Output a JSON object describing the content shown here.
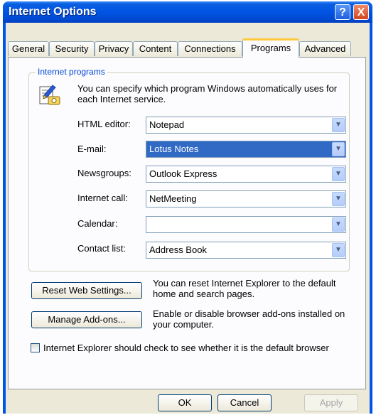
{
  "window": {
    "title": "Internet Options",
    "help_label": "?",
    "close_label": "X"
  },
  "tabs": [
    {
      "label": "General"
    },
    {
      "label": "Security"
    },
    {
      "label": "Privacy"
    },
    {
      "label": "Content"
    },
    {
      "label": "Connections"
    },
    {
      "label": "Programs",
      "active": true
    },
    {
      "label": "Advanced"
    }
  ],
  "programs": {
    "group_label": "Internet programs",
    "intro": "You can specify which program Windows automatically uses for each Internet service.",
    "icon": "program-settings-icon",
    "fields": [
      {
        "label": "HTML editor:",
        "value": "Notepad"
      },
      {
        "label": "E-mail:",
        "value": "Lotus Notes",
        "selected": true
      },
      {
        "label": "Newsgroups:",
        "value": "Outlook Express"
      },
      {
        "label": "Internet call:",
        "value": "NetMeeting"
      },
      {
        "label": "Calendar:",
        "value": ""
      },
      {
        "label": "Contact list:",
        "value": "Address Book"
      }
    ]
  },
  "reset": {
    "button_label": "Reset Web Settings...",
    "description": "You can reset Internet Explorer to the default home and search pages."
  },
  "addons": {
    "button_label": "Manage Add-ons...",
    "description": "Enable or disable browser add-ons installed on your computer."
  },
  "default_check": {
    "label": "Internet Explorer should check to see whether it is the default browser",
    "checked": false
  },
  "footer": {
    "ok_label": "OK",
    "cancel_label": "Cancel",
    "apply_label": "Apply",
    "apply_enabled": false
  },
  "colors": {
    "title_bar": "#0054e3",
    "dialog_bg": "#ece9d8",
    "selection": "#316ac5",
    "group_label": "#0046d5"
  }
}
